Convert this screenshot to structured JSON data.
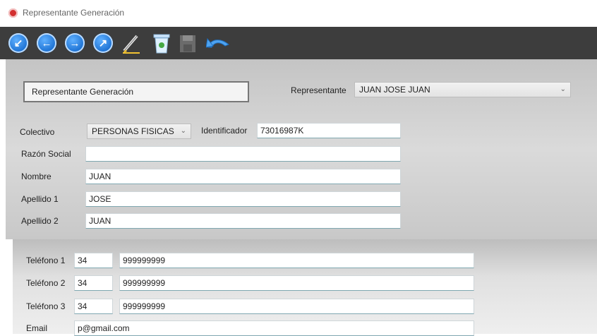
{
  "window": {
    "title": "Representante Generación"
  },
  "toolbar": {
    "buttons": [
      "first-icon",
      "prev-icon",
      "next-icon",
      "last-icon",
      "edit-icon",
      "delete-icon",
      "save-icon",
      "undo-icon"
    ]
  },
  "form": {
    "section_title": "Representante Generación",
    "representante": {
      "label": "Representante",
      "value": "JUAN JOSE JUAN"
    },
    "colectivo": {
      "label": "Colectivo",
      "value": "PERSONAS FISICAS"
    },
    "identificador": {
      "label": "Identificador",
      "value": "73016987K"
    },
    "razon_social": {
      "label": "Razón Social",
      "value": ""
    },
    "nombre": {
      "label": "Nombre",
      "value": "JUAN"
    },
    "apellido1": {
      "label": "Apellido 1",
      "value": "JOSE"
    },
    "apellido2": {
      "label": "Apellido 2",
      "value": "JUAN"
    }
  },
  "contact": {
    "telefono1": {
      "label": "Teléfono 1",
      "prefix": "34",
      "number": "999999999"
    },
    "telefono2": {
      "label": "Teléfono 2",
      "prefix": "34",
      "number": "999999999"
    },
    "telefono3": {
      "label": "Teléfono 3",
      "prefix": "34",
      "number": "999999999"
    },
    "email": {
      "label": "Email",
      "value": "p@gmail.com"
    }
  }
}
